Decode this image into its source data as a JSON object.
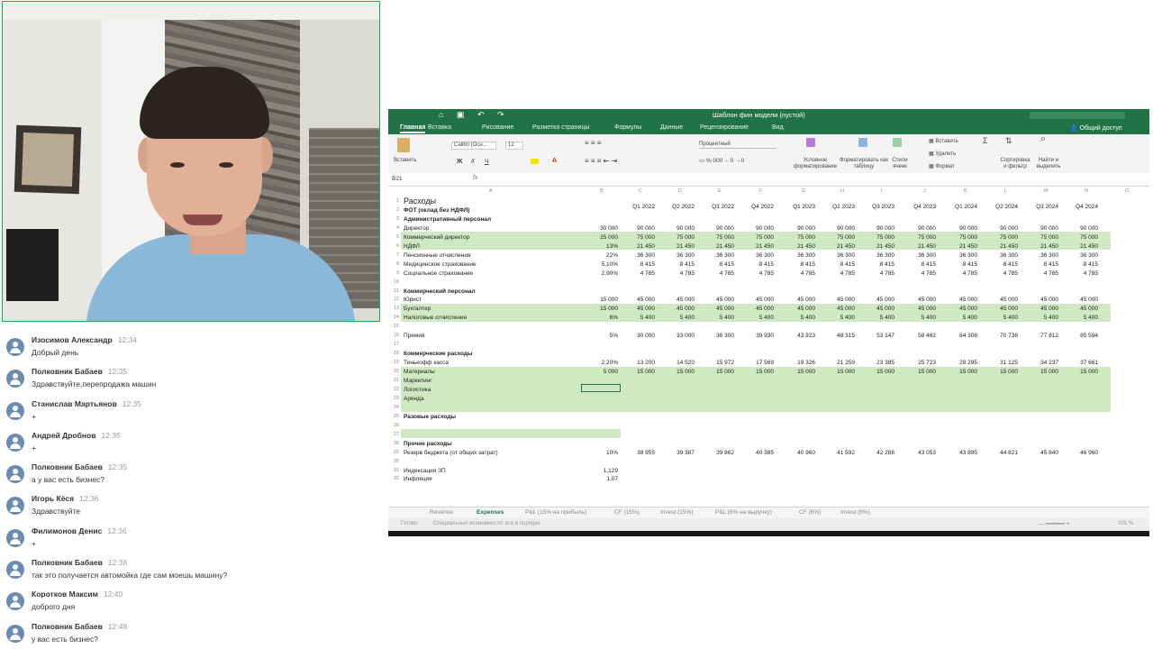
{
  "chat": [
    {
      "name": "Изосимов Александр",
      "time": "12:34",
      "text": "Добрый день"
    },
    {
      "name": "Полковник Бабаев",
      "time": "12:35",
      "text": "Здравствуйте,перепродажа машин"
    },
    {
      "name": "Станислав Мартьянов",
      "time": "12:35",
      "text": "+"
    },
    {
      "name": "Андрей Дробнов",
      "time": "12:35",
      "text": "+"
    },
    {
      "name": "Полковник Бабаев",
      "time": "12:35",
      "text": "а у вас есть бизнес?"
    },
    {
      "name": "Игорь Кёся",
      "time": "12:36",
      "text": "Здравствуйте"
    },
    {
      "name": "Филимонов Денис",
      "time": "12:36",
      "text": "+"
    },
    {
      "name": "Полковник Бабаев",
      "time": "12:38",
      "text": "так это получается автомойка где сам моешь машину?"
    },
    {
      "name": "Коротков Максим",
      "time": "12:40",
      "text": "доброго дня"
    },
    {
      "name": "Полковник Бабаев",
      "time": "12:48",
      "text": "у вас есть бизнес?"
    }
  ],
  "excel": {
    "title": "Шаблон фин модели (пустой)",
    "share": "Общий доступ",
    "tabs": [
      "Главная",
      "Вставка",
      "Рисование",
      "Разметка страницы",
      "Формулы",
      "Данные",
      "Рецензирование",
      "Вид"
    ],
    "ribbon": {
      "paste": "Вставить",
      "font": "Calibri (Осн...",
      "size": "12",
      "number_format": "Процентный",
      "cond": "Условное форматирование",
      "table": "Форматировать как таблицу",
      "styles": "Стили ячеек",
      "insert": "Вставить",
      "delete": "Удалить",
      "format": "Формат",
      "sort": "Сортировка и фильтр",
      "find": "Найти и выделить"
    },
    "namebox": "B21",
    "fx": "fx",
    "columns": [
      "A",
      "B",
      "C",
      "D",
      "E",
      "F",
      "G",
      "H",
      "I",
      "J",
      "K",
      "L",
      "M",
      "N",
      "O"
    ],
    "quarters": [
      "Q1 2022",
      "Q2 2022",
      "Q3 2022",
      "Q4 2022",
      "Q1 2023",
      "Q2 2023",
      "Q3 2023",
      "Q4 2023",
      "Q1 2024",
      "Q2 2024",
      "Q3 2024",
      "Q4 2024"
    ],
    "rows": [
      {
        "n": "1",
        "a": "Расходы",
        "b": "",
        "q": []
      },
      {
        "n": "2",
        "a": "ФОТ (оклад без НДФЛ)",
        "b": "",
        "q": []
      },
      {
        "n": "3",
        "a": "Административный персонал",
        "b": "",
        "q": []
      },
      {
        "n": "4",
        "a": "Директор",
        "b": "30 000",
        "q": [
          "90 000",
          "90 000",
          "90 000",
          "90 000",
          "90 000",
          "90 000",
          "90 000",
          "90 000",
          "90 000",
          "90 000",
          "90 000",
          "90 000"
        ]
      },
      {
        "n": "5",
        "a": "Коммерческий директор",
        "b": "25 000",
        "q": [
          "75 000",
          "75 000",
          "75 000",
          "75 000",
          "75 000",
          "75 000",
          "75 000",
          "75 000",
          "75 000",
          "75 000",
          "75 000",
          "75 000"
        ]
      },
      {
        "n": "6",
        "a": "НДФЛ",
        "b": "13%",
        "q": [
          "21 450",
          "21 450",
          "21 450",
          "21 450",
          "21 450",
          "21 450",
          "21 450",
          "21 450",
          "21 450",
          "21 450",
          "21 450",
          "21 450"
        ]
      },
      {
        "n": "7",
        "a": "Пенсионные отчисления",
        "b": "22%",
        "q": [
          "36 300",
          "36 300",
          "36 300",
          "36 300",
          "36 300",
          "36 300",
          "36 300",
          "36 300",
          "36 300",
          "36 300",
          "36 300",
          "36 300"
        ]
      },
      {
        "n": "8",
        "a": "Медицинское страхование",
        "b": "5,10%",
        "q": [
          "8 415",
          "8 415",
          "8 415",
          "8 415",
          "8 415",
          "8 415",
          "8 415",
          "8 415",
          "8 415",
          "8 415",
          "8 415",
          "8 415"
        ]
      },
      {
        "n": "9",
        "a": "Социальное страхование",
        "b": "2,90%",
        "q": [
          "4 785",
          "4 785",
          "4 785",
          "4 785",
          "4 785",
          "4 785",
          "4 785",
          "4 785",
          "4 785",
          "4 785",
          "4 785",
          "4 785"
        ]
      },
      {
        "n": "10",
        "a": "",
        "b": "",
        "q": []
      },
      {
        "n": "11",
        "a": "Коммерческий персонал",
        "b": "",
        "q": []
      },
      {
        "n": "12",
        "a": "Юрист",
        "b": "15 000",
        "q": [
          "45 000",
          "45 000",
          "45 000",
          "45 000",
          "45 000",
          "45 000",
          "45 000",
          "45 000",
          "45 000",
          "45 000",
          "45 000",
          "45 000"
        ]
      },
      {
        "n": "13",
        "a": "Бухгалтер",
        "b": "15 000",
        "q": [
          "45 000",
          "45 000",
          "45 000",
          "45 000",
          "45 000",
          "45 000",
          "45 000",
          "45 000",
          "45 000",
          "45 000",
          "45 000",
          "45 000"
        ]
      },
      {
        "n": "14",
        "a": "Налоговые отчисления",
        "b": "6%",
        "q": [
          "5 400",
          "5 400",
          "5 400",
          "5 400",
          "5 400",
          "5 400",
          "5 400",
          "5 400",
          "5 400",
          "5 400",
          "5 400",
          "5 400"
        ]
      },
      {
        "n": "15",
        "a": "",
        "b": "",
        "q": []
      },
      {
        "n": "16",
        "a": "Премия",
        "b": "5%",
        "q": [
          "30 000",
          "33 000",
          "36 300",
          "39 930",
          "43 923",
          "48 315",
          "53 147",
          "58 462",
          "64 308",
          "70 738",
          "77 812",
          "85 594"
        ]
      },
      {
        "n": "17",
        "a": "",
        "b": "",
        "q": []
      },
      {
        "n": "18",
        "a": "Коммерческие расходы",
        "b": "",
        "q": []
      },
      {
        "n": "19",
        "a": "Тинькофф касса",
        "b": "2,20%",
        "q": [
          "13 200",
          "14 520",
          "15 972",
          "17 569",
          "19 326",
          "21 259",
          "23 385",
          "25 723",
          "28 295",
          "31 125",
          "34 237",
          "37 661"
        ]
      },
      {
        "n": "20",
        "a": "Материалы",
        "b": "5 000",
        "q": [
          "15 000",
          "15 000",
          "15 000",
          "15 000",
          "15 000",
          "15 000",
          "15 000",
          "15 000",
          "15 000",
          "15 000",
          "15 000",
          "15 000"
        ]
      },
      {
        "n": "21",
        "a": "Маркетинг",
        "b": "",
        "q": []
      },
      {
        "n": "22",
        "a": "Логистика",
        "b": "",
        "q": []
      },
      {
        "n": "23",
        "a": "Аренда",
        "b": "",
        "q": []
      },
      {
        "n": "24",
        "a": "",
        "b": "",
        "q": []
      },
      {
        "n": "25",
        "a": "Разовые расходы",
        "b": "",
        "q": []
      },
      {
        "n": "26",
        "a": "",
        "b": "",
        "q": []
      },
      {
        "n": "27",
        "a": "",
        "b": "",
        "q": []
      },
      {
        "n": "28",
        "a": "Прочие расходы",
        "b": "",
        "q": []
      },
      {
        "n": "29",
        "a": "Резерв бюджета (от общих затрат)",
        "b": "10%",
        "q": [
          "38 955",
          "39 387",
          "39 862",
          "40 385",
          "40 960",
          "41 592",
          "42 288",
          "43 053",
          "43 895",
          "44 821",
          "45 840",
          "46 960"
        ]
      },
      {
        "n": "30",
        "a": "",
        "b": "",
        "q": []
      },
      {
        "n": "31",
        "a": "Индексация ЗП",
        "b": "1,129",
        "q": []
      },
      {
        "n": "32",
        "a": "Инфляция",
        "b": "1,07",
        "q": []
      }
    ],
    "sheet_tabs": [
      "Revenue",
      "Expenses",
      "P&L (15% на прибыль)",
      "CF (15%)",
      "Invest (15%)",
      "P&L (6% на выручку)",
      "CF (6%)",
      "Invest (6%)"
    ],
    "active_sheet": "Expenses",
    "status_ready": "Готово",
    "status_access": "Специальные возможности: все в порядке",
    "zoom": "105 %"
  }
}
